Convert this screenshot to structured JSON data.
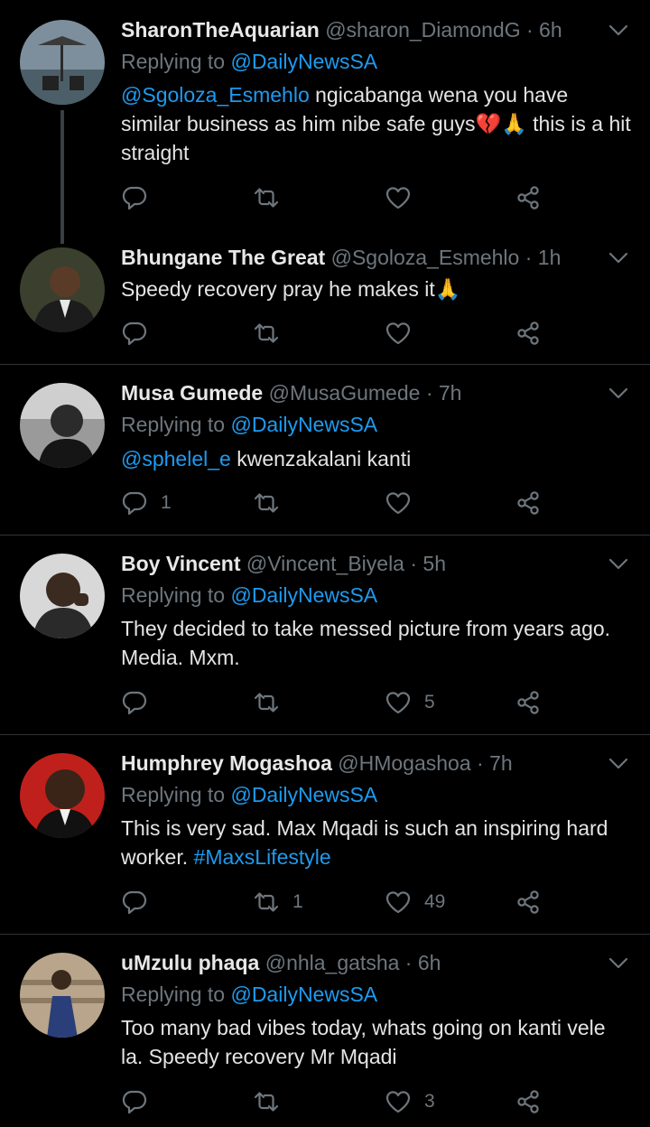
{
  "tweets": [
    {
      "name": "SharonTheAquarian",
      "handle": "@sharon_DiamondG",
      "time": "· 6h",
      "reply_prefix": "Replying to ",
      "reply_to": "@DailyNewsSA",
      "mention": "@Sgoloza_Esmehlo",
      "text": " ngicabanga wena you have similar business as him nibe safe guys💔🙏 this is a hit straight",
      "replies": "",
      "retweets": "",
      "likes": ""
    },
    {
      "name": "Bhungane The Great",
      "handle": "@Sgoloza_Esmehlo",
      "time": "· 1h",
      "text": "Speedy recovery pray he makes it🙏",
      "replies": "",
      "retweets": "",
      "likes": ""
    },
    {
      "name": "Musa Gumede",
      "handle": "@MusaGumede",
      "time": "· 7h",
      "reply_prefix": "Replying to ",
      "reply_to": "@DailyNewsSA",
      "mention": "@sphelel_e",
      "text": " kwenzakalani kanti",
      "replies": "1",
      "retweets": "",
      "likes": ""
    },
    {
      "name": "Boy Vincent",
      "handle": "@Vincent_Biyela",
      "time": "· 5h",
      "reply_prefix": "Replying to ",
      "reply_to": "@DailyNewsSA",
      "text": "They decided to take messed picture from years ago. Media. Mxm.",
      "replies": "",
      "retweets": "",
      "likes": "5"
    },
    {
      "name": "Humphrey Mogashoa",
      "handle": "@HMogashoa",
      "time": "· 7h",
      "reply_prefix": "Replying to ",
      "reply_to": "@DailyNewsSA",
      "text": "This is very sad. Max Mqadi is such an inspiring hard worker. ",
      "hashtag": "#MaxsLifestyle",
      "replies": "",
      "retweets": "1",
      "likes": "49"
    },
    {
      "name": "uMzulu phaqa",
      "handle": "@nhla_gatsha",
      "time": "· 6h",
      "reply_prefix": "Replying to ",
      "reply_to": "@DailyNewsSA",
      "text": "Too many bad vibes today, whats going on kanti vele la. Speedy recovery Mr Mqadi",
      "replies": "",
      "retweets": "",
      "likes": "3"
    }
  ],
  "icons": {
    "reply": "reply-icon",
    "retweet": "retweet-icon",
    "like": "heart-icon",
    "share": "share-icon",
    "more": "chevron-down-icon"
  },
  "colors": {
    "background": "#000000",
    "link": "#1d9bf0",
    "muted": "#6e767d",
    "divider": "#2f3336"
  }
}
